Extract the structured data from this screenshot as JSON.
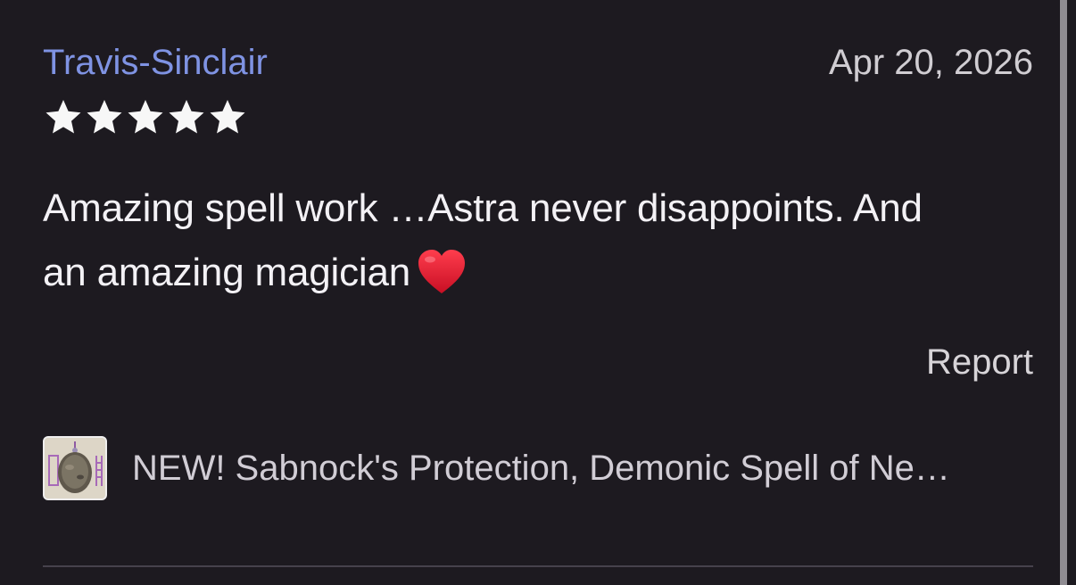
{
  "review": {
    "author": "Travis-Sinclair",
    "date": "Apr 20, 2026",
    "rating": 5,
    "rating_max": 5,
    "text": "Amazing spell work …Astra never disappoints. And\nan amazing magician",
    "emoji": "heart-icon",
    "report_label": "Report"
  },
  "product": {
    "title": "NEW! Sabnock's Protection, Demonic Spell of Ne…",
    "thumbnail": "product-thumbnail"
  },
  "colors": {
    "background": "#1d1a20",
    "author_link": "#7f93e3",
    "text": "#f3f1f5",
    "muted_text": "#d1cdd5",
    "star": "#f7f7f7",
    "heart": "#e21f33",
    "divider": "#46424c"
  }
}
